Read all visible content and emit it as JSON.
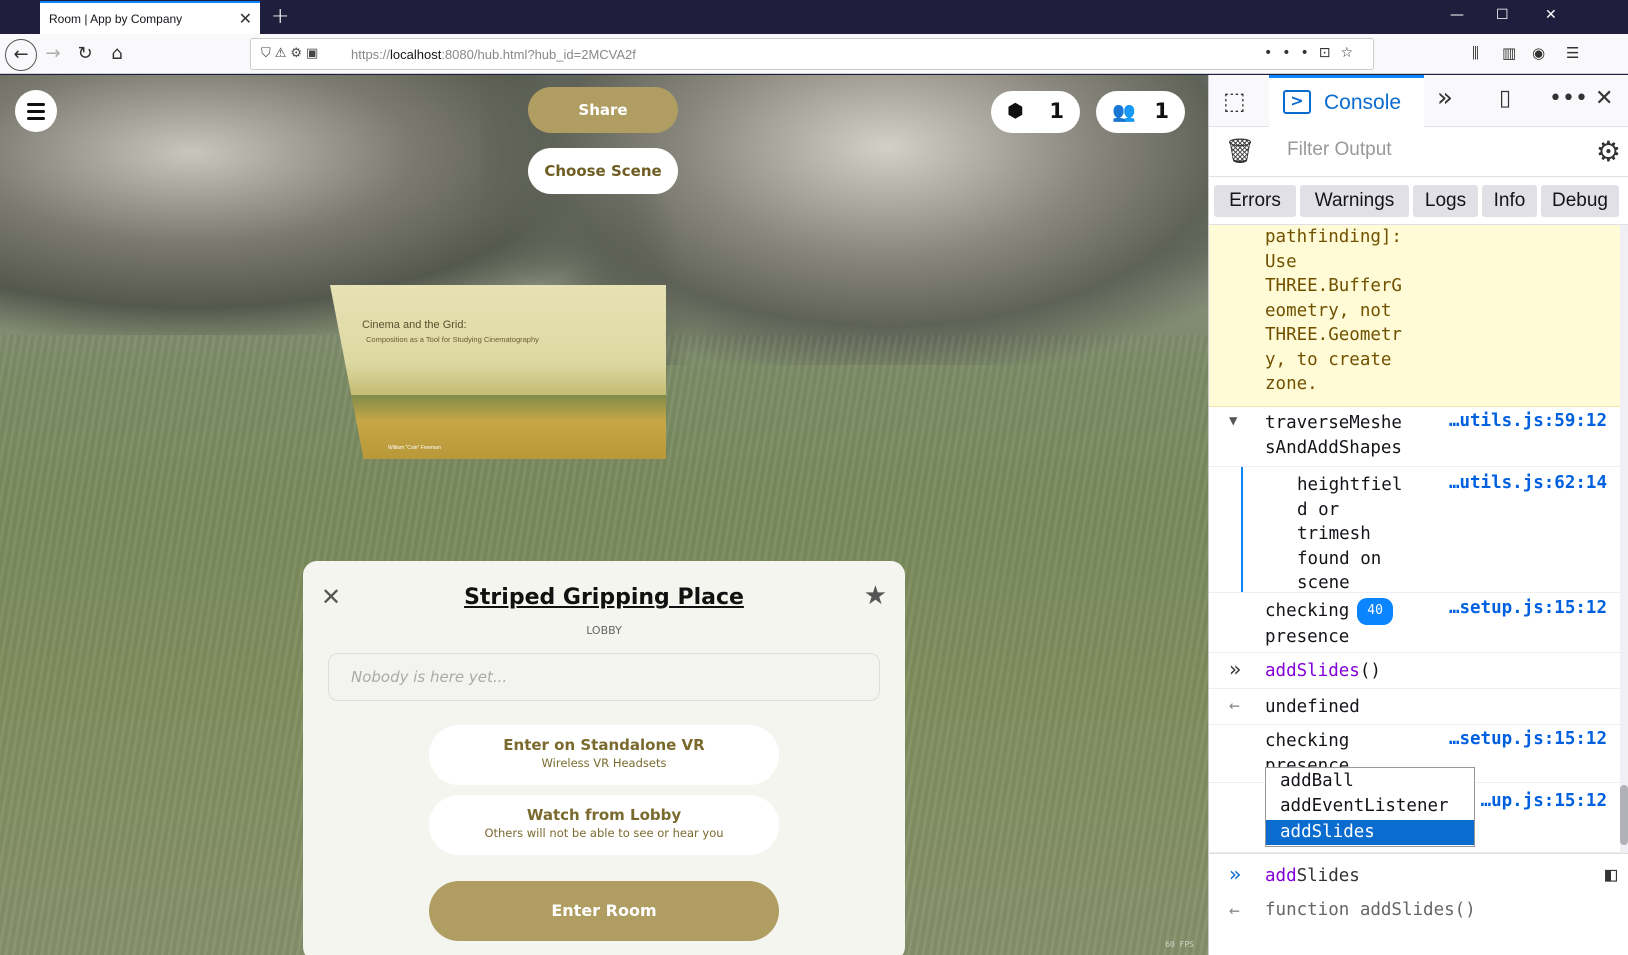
{
  "browser": {
    "tab_title": "Room | App by Company",
    "url_scheme": "https://",
    "url_host": "localhost",
    "url_rest": ":8080/hub.html?hub_id=2MCVA2f"
  },
  "scene": {
    "share_label": "Share",
    "choose_scene_label": "Choose Scene",
    "objects_count": "1",
    "people_count": "1",
    "slide_title": "Cinema and the Grid:",
    "slide_subtitle": "Composition as a Tool for Studying Cinematography",
    "slide_author": "William \"Cole\" Freeman",
    "fps": "60 FPS"
  },
  "dialog": {
    "title": "Striped Gripping Place",
    "subtitle": "LOBBY",
    "presence_placeholder": "Nobody is here yet...",
    "options": [
      {
        "label": "Enter on Standalone VR",
        "sub": "Wireless VR Headsets"
      },
      {
        "label": "Watch from Lobby",
        "sub": "Others will not be able to see or hear you"
      }
    ],
    "enter_label": "Enter Room"
  },
  "devtools": {
    "active_tab": "Console",
    "filter_placeholder": "Filter Output",
    "levels": [
      "Errors",
      "Warnings",
      "Logs",
      "Info",
      "Debug"
    ],
    "log": {
      "warn_lines": [
        "pathfinding]:",
        "Use",
        "THREE.BufferG",
        "eometry, not",
        "THREE.Geometr",
        "y, to create",
        "zone."
      ],
      "trace_fn": [
        "traverseMeshe",
        "sAndAddShapes"
      ],
      "trace_src": "…utils.js:59:12",
      "nested_lines": [
        "heightfiel",
        "d or",
        "trimesh",
        "found on",
        "scene"
      ],
      "nested_src": "…utils.js:62:14",
      "checking_1": [
        "checking",
        "presence"
      ],
      "checking_1_count": "40",
      "checking_1_src": "…setup.js:15:12",
      "input_1_fn": "addSlides",
      "input_1_parens": "()",
      "result_1": "undefined",
      "checking_2": "checking",
      "checking_2_cut": "presence",
      "checking_2_src": "…setup.js:15:12",
      "checking_3_src": "…up.js:15:12"
    },
    "autocomplete": [
      "addBall",
      "addEventListener",
      "addSlides"
    ],
    "input_prefix": "add",
    "input_suffix": "Slides",
    "preview": "function addSlides()"
  }
}
